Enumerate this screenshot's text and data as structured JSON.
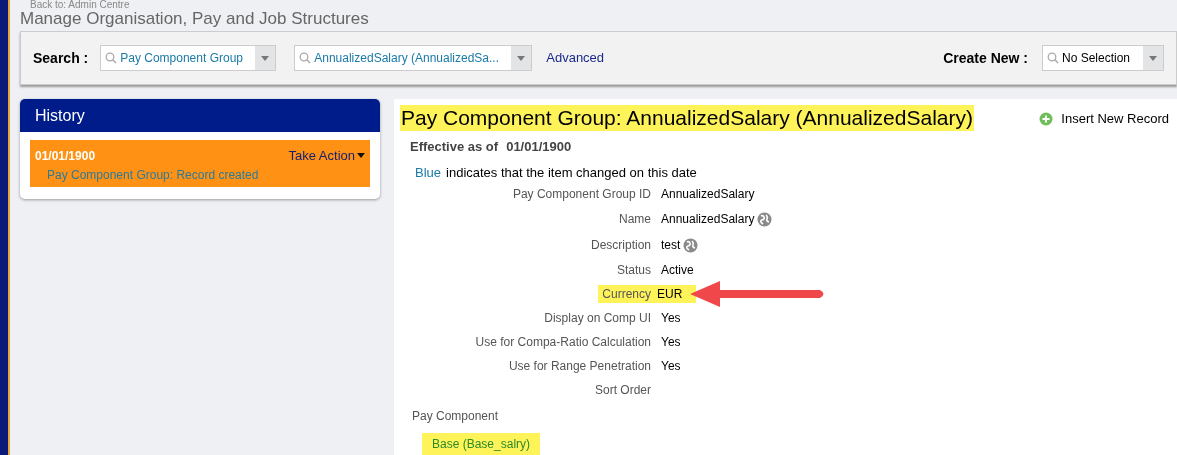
{
  "breadcrumb": "Back to: Admin Centre",
  "page_title": "Manage Organisation, Pay and Job Structures",
  "search_bar": {
    "label": "Search :",
    "fields": [
      {
        "value": "Pay Component Group"
      },
      {
        "value": "AnnualizedSalary (AnnualizedSa..."
      }
    ],
    "advanced_link": "Advanced",
    "create_label": "Create New :",
    "create_field": {
      "value": "No Selection"
    }
  },
  "history": {
    "title": "History",
    "entries": [
      {
        "date": "01/01/1900",
        "action": "Take Action",
        "description": "Pay Component Group: Record created",
        "selected": true
      }
    ]
  },
  "record": {
    "title": "Pay Component Group: AnnualizedSalary (AnnualizedSalary)",
    "title_highlighted": true,
    "insert_button": "Insert New Record",
    "effective_label": "Effective as of",
    "effective_date": "01/01/1900",
    "legend_word": "Blue",
    "legend_text": "indicates that the item changed on this date",
    "fields": [
      {
        "label": "Pay Component Group ID",
        "value": "AnnualizedSalary",
        "translatable": false,
        "highlighted": false
      },
      {
        "label": "Name",
        "value": "AnnualizedSalary",
        "translatable": true,
        "highlighted": false
      },
      {
        "label": "Description",
        "value": "test",
        "translatable": true,
        "highlighted": false
      },
      {
        "label": "Status",
        "value": "Active",
        "translatable": false,
        "highlighted": false
      },
      {
        "label": "Currency",
        "value": "EUR",
        "translatable": false,
        "highlighted": true,
        "annotated": true
      },
      {
        "label": "Display on Comp UI",
        "value": "Yes",
        "translatable": false,
        "highlighted": false
      },
      {
        "label": "Use for Compa-Ratio Calculation",
        "value": "Yes",
        "translatable": false,
        "highlighted": false
      },
      {
        "label": "Use for Range Penetration",
        "value": "Yes",
        "translatable": false,
        "highlighted": false
      },
      {
        "label": "Sort Order",
        "translatable": false,
        "highlighted": false
      }
    ],
    "pay_component_label": "Pay Component",
    "pay_components": [
      {
        "text": "Base (Base_salry)",
        "highlighted": true
      }
    ]
  }
}
